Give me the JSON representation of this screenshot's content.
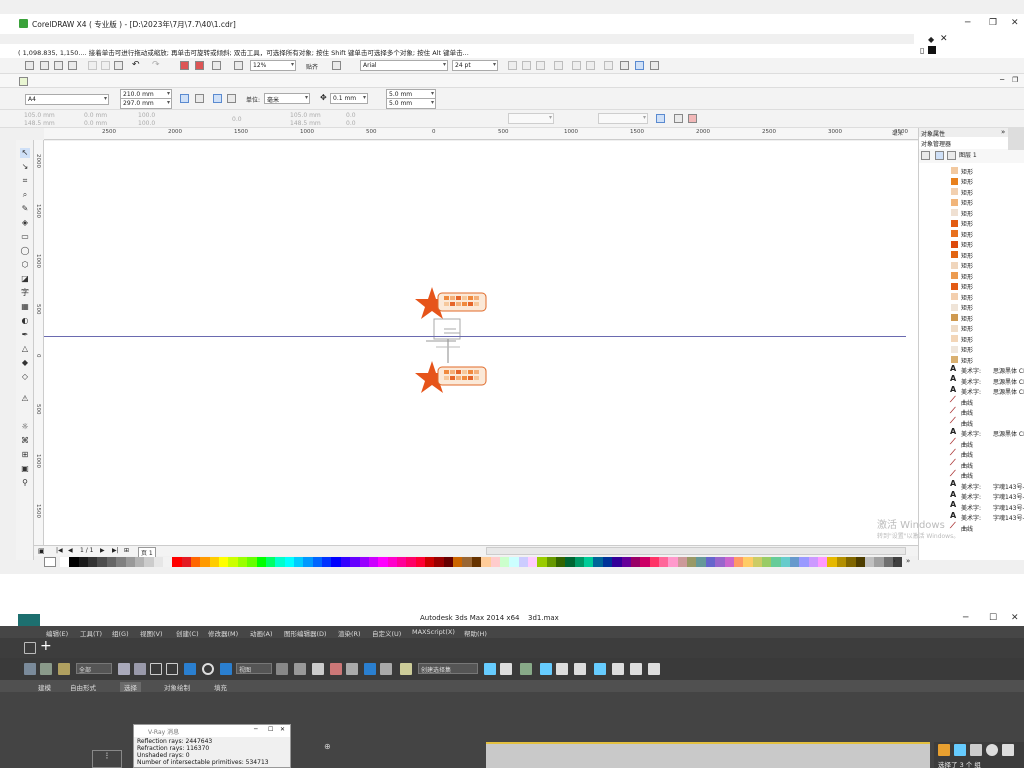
{
  "coreldraw": {
    "window_title": "CorelDRAW X4 ( 专业版 ) - [D:\\2023年\\7月\\7.7\\40\\1.cdr]",
    "status_text": "( 1,098.835, 1,150.... 接着单击可进行拖动或缩放; 再单击可旋转或倾斜; 双击工具，可选择所有对象; 按住 Shift 键单击可选择多个对象; 按住 Alt 键单击...",
    "toolbar": {
      "zoom": "12%",
      "snap": "贴齐",
      "font": "Arial",
      "font_size": "24 pt"
    },
    "property_bar": {
      "page_size": "A4",
      "width": "210.0 mm",
      "height": "297.0 mm",
      "units_label": "单位:",
      "units": "毫米",
      "nudge": "0.1 mm",
      "dup_x": "5.0 mm",
      "dup_y": "5.0 mm"
    },
    "property_bar2": {
      "x": "105.0 mm",
      "y": "148.5 mm",
      "w": "0.0 mm",
      "h": "0.0 mm",
      "sx": "100.0",
      "sy": "100.0",
      "rot": "0.0",
      "cx": "105.0 mm",
      "cy": "148.5 mm",
      "a1": "0.0",
      "a2": "0.0"
    },
    "ruler_ticks": [
      "2500",
      "2000",
      "1500",
      "1000",
      "500",
      "0",
      "500",
      "1000",
      "1500",
      "2000",
      "2500",
      "3000",
      "3500"
    ],
    "ruler_unit": "毫米",
    "vruler_ticks": [
      "2000",
      "1500",
      "1000",
      "500",
      "0",
      "500",
      "1000",
      "1500"
    ],
    "page_nav": {
      "counter": "1 / 1",
      "page_tab": "页 1"
    },
    "docker": {
      "tab1": "对象属性",
      "tab2": "对象管理器",
      "layer_label": "图层 1",
      "items": [
        {
          "icon": "rect",
          "label": "矩形",
          "color": "#f2c9a0"
        },
        {
          "icon": "rect",
          "label": "矩形",
          "color": "#e8801c"
        },
        {
          "icon": "rect",
          "label": "矩形",
          "color": "#f2d0b0"
        },
        {
          "icon": "rect",
          "label": "矩形",
          "color": "#f1b57a"
        },
        {
          "icon": "rect",
          "label": "矩形",
          "color": "#efe0d2"
        },
        {
          "icon": "rect",
          "label": "矩形",
          "color": "#e35c12"
        },
        {
          "icon": "rect",
          "label": "矩形",
          "color": "#e8701e"
        },
        {
          "icon": "rect",
          "label": "矩形",
          "color": "#dd4a0c"
        },
        {
          "icon": "rect",
          "label": "矩形",
          "color": "#e26412"
        },
        {
          "icon": "rect",
          "label": "矩形",
          "color": "#f0d6bd"
        },
        {
          "icon": "rect",
          "label": "矩形",
          "color": "#ec9b50"
        },
        {
          "icon": "rect",
          "label": "矩形",
          "color": "#e35a14"
        },
        {
          "icon": "rect",
          "label": "矩形",
          "color": "#f3cfaf"
        },
        {
          "icon": "rect",
          "label": "矩形",
          "color": "#efe4d8"
        },
        {
          "icon": "rect",
          "label": "矩形",
          "color": "#cf9a50"
        },
        {
          "icon": "rect",
          "label": "矩形",
          "color": "#f0ddc8"
        },
        {
          "icon": "rect",
          "label": "矩形",
          "color": "#f3d6b8"
        },
        {
          "icon": "rect",
          "label": "矩形",
          "color": "#efe6dc"
        },
        {
          "icon": "rect",
          "label": "矩形",
          "color": "#d9b070"
        },
        {
          "icon": "text",
          "label": "美术字:",
          "font": "思源黑体 CI"
        },
        {
          "icon": "text",
          "label": "美术字:",
          "font": "思源黑体 CI"
        },
        {
          "icon": "text",
          "label": "美术字:",
          "font": "思源黑体 CI"
        },
        {
          "icon": "curve",
          "label": "曲线"
        },
        {
          "icon": "curve",
          "label": "曲线"
        },
        {
          "icon": "curve",
          "label": "曲线"
        },
        {
          "icon": "text",
          "label": "美术字:",
          "font": "思源黑体 CI"
        },
        {
          "icon": "curve",
          "label": "曲线"
        },
        {
          "icon": "curve",
          "label": "曲线"
        },
        {
          "icon": "curve",
          "label": "曲线"
        },
        {
          "icon": "curve",
          "label": "曲线"
        },
        {
          "icon": "text",
          "label": "美术字:",
          "font": "字魂143号-"
        },
        {
          "icon": "text",
          "label": "美术字:",
          "font": "字魂143号-"
        },
        {
          "icon": "text",
          "label": "美术字:",
          "font": "字魂143号-"
        },
        {
          "icon": "text",
          "label": "美术字:",
          "font": "字魂143号-"
        },
        {
          "icon": "curve",
          "label": "曲线"
        }
      ]
    },
    "windows_activation": {
      "line1": "激活 Windows",
      "line2": "转到\"设置\"以激活 Windows。"
    },
    "palette": [
      "#ffffff",
      "#000000",
      "#1a1a1a",
      "#333333",
      "#4d4d4d",
      "#666666",
      "#808080",
      "#999999",
      "#b3b3b3",
      "#cccccc",
      "#e6e6e6",
      "#f2f2f2",
      "#ff0000",
      "#e31b23",
      "#ff6600",
      "#ff9900",
      "#ffcc00",
      "#ffff00",
      "#ccff00",
      "#99ff00",
      "#66ff00",
      "#00ff00",
      "#00ff66",
      "#00ffcc",
      "#00ffff",
      "#00ccff",
      "#0099ff",
      "#0066ff",
      "#0033ff",
      "#0000ff",
      "#3300ff",
      "#6600ff",
      "#9900ff",
      "#cc00ff",
      "#ff00ff",
      "#ff00cc",
      "#ff0099",
      "#ff0066",
      "#ff0033",
      "#cc0000",
      "#990000",
      "#660000",
      "#cc6600",
      "#996633",
      "#663300",
      "#ffcc99",
      "#ffcccc",
      "#ccffcc",
      "#ccffff",
      "#ccccff",
      "#ffccff",
      "#99cc00",
      "#669900",
      "#336600",
      "#006633",
      "#009966",
      "#00cc99",
      "#006699",
      "#003399",
      "#330099",
      "#660099",
      "#990066",
      "#cc0066",
      "#ff3366",
      "#ff6699",
      "#ff99cc",
      "#cc9999",
      "#999966",
      "#669999",
      "#6666cc",
      "#9966cc",
      "#cc66cc",
      "#ff9966",
      "#ffcc66",
      "#cccc66",
      "#99cc66",
      "#66cc99",
      "#66cccc",
      "#6699cc",
      "#9999ff",
      "#cc99ff",
      "#ff99ff",
      "#e6b800",
      "#b38f00",
      "#806600",
      "#4d3d00",
      "#c0c0c0",
      "#a0a0a0",
      "#707070",
      "#404040"
    ]
  },
  "max": {
    "window_title": "Autodesk 3ds Max  2014 x64",
    "file": "3d1.max",
    "menu": [
      "编辑(E)",
      "工具(T)",
      "组(G)",
      "视图(V)",
      "创建(C)",
      "修改器(M)",
      "动画(A)",
      "图形编辑器(D)",
      "渲染(R)",
      "自定义(U)",
      "MAXScript(X)",
      "帮助(H)"
    ],
    "select_filter": "全部",
    "ref_coord": "视图",
    "named_selection": "创建选择集",
    "ribbon_tabs": [
      "建模",
      "自由形式",
      "选择",
      "对象绘制",
      "填充"
    ],
    "vray": {
      "title": "V-Ray 消息",
      "lines": [
        "Reflection rays: 2447643",
        "Refraction rays: 116370",
        "Unshaded rays: 0",
        "Number of intersectable primitives: 534713"
      ]
    },
    "right_panel_status": "选择了 3 个 组",
    "viewport_label": "+"
  }
}
